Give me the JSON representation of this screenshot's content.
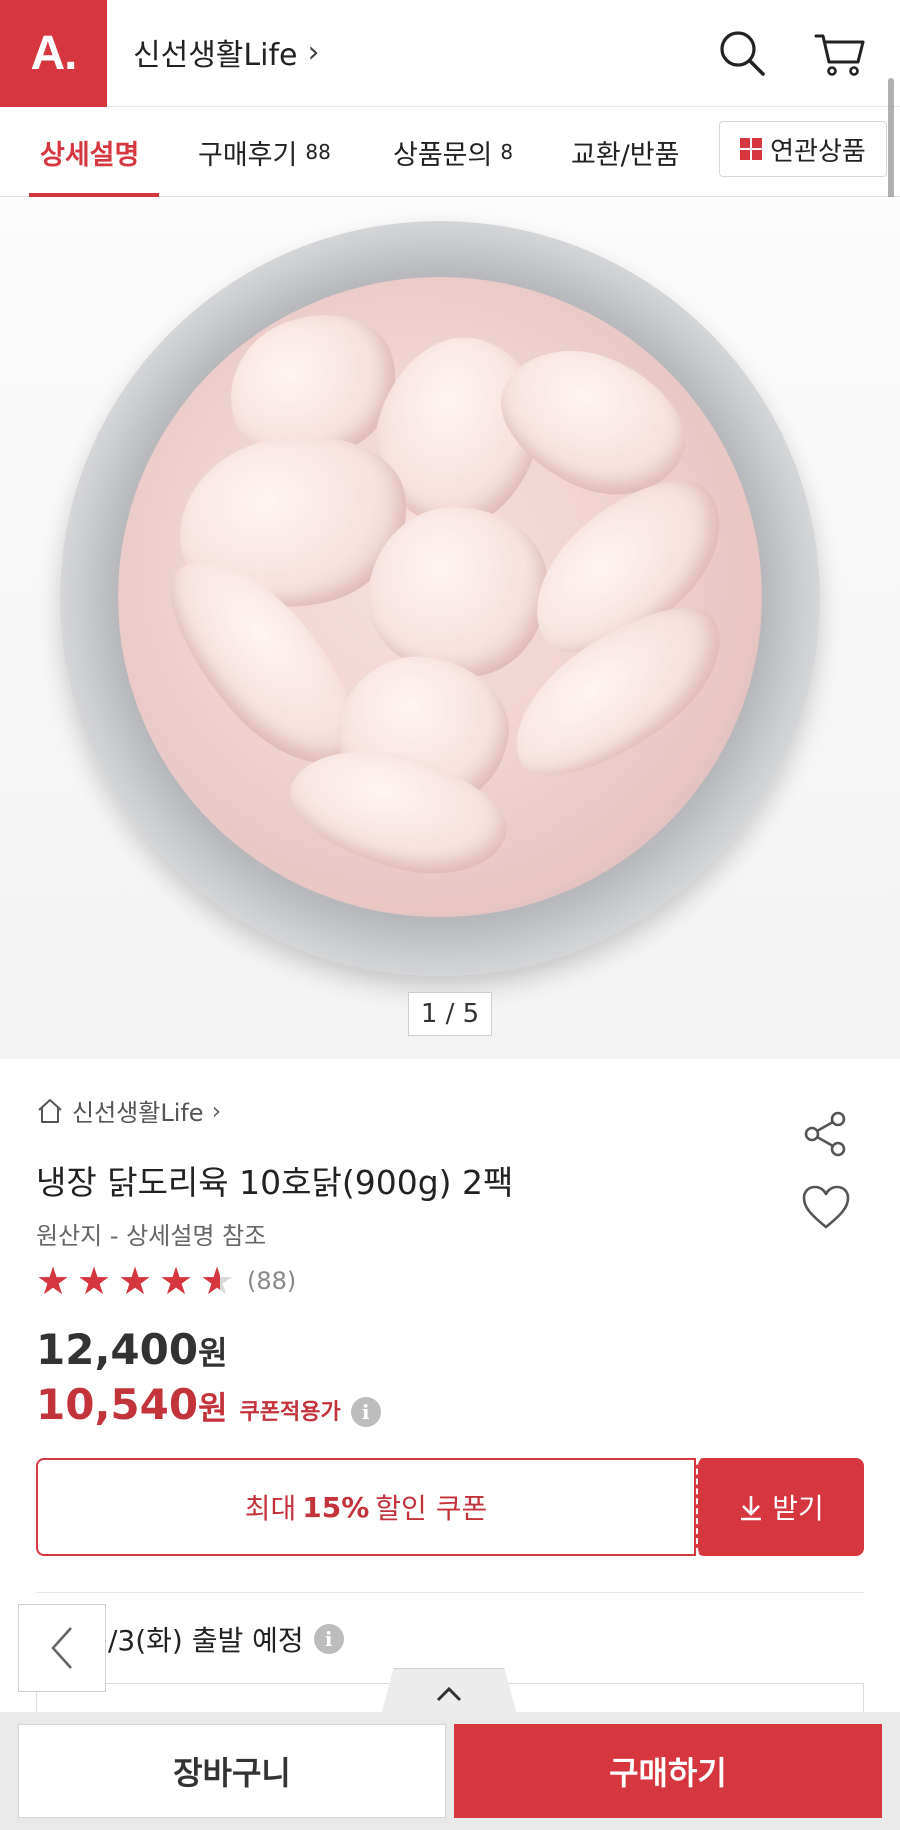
{
  "header": {
    "logo_text": "A.",
    "store_title": "신선생활Life",
    "chevron": "›",
    "icons": [
      "search-icon",
      "cart-icon"
    ]
  },
  "tabs": [
    {
      "label": "상세설명",
      "count": ""
    },
    {
      "label": "구매후기",
      "count": "88"
    },
    {
      "label": "상품문의",
      "count": "8"
    },
    {
      "label": "교환/반품",
      "count": ""
    }
  ],
  "related_button": "연관상품",
  "image": {
    "indicator": "1 / 5"
  },
  "product": {
    "store": "신선생활Life",
    "store_chevron": "›",
    "title": "냉장 닭도리육 10호닭(900g) 2팩",
    "origin": "원산지 - 상세설명 참조",
    "rating": 4.5,
    "review_count": "(88)",
    "price": "12,400",
    "price_unit": "원",
    "sale_price": "10,540",
    "sale_unit": "원",
    "sale_note": "쿠폰적용가"
  },
  "coupon": {
    "prefix": "최대",
    "percent": "15%",
    "suffix": "할인 쿠폰",
    "download": "받기"
  },
  "shipping": {
    "text": "/3(화) 출발 예정"
  },
  "bottom": {
    "cart": "장바구니",
    "buy": "구매하기"
  },
  "colors": {
    "brand": "#d6363d",
    "sale": "#c3333a"
  }
}
